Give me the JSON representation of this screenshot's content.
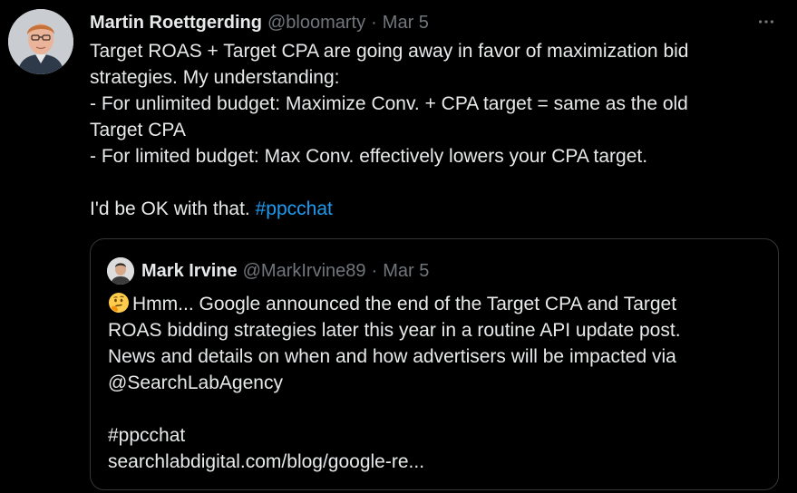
{
  "tweet": {
    "author_name": "Martin Roettgerding",
    "author_handle": "@bloomarty",
    "separator": "·",
    "date": "Mar 5",
    "lines": [
      "Target ROAS + Target CPA are going away in favor of maximization bid",
      "strategies. My understanding:",
      "- For unlimited budget: Maximize Conv. + CPA target = same as the old",
      "Target CPA",
      "- For limited budget: Max Conv. effectively lowers your CPA target.",
      "",
      "I'd be OK with that. "
    ],
    "hashtag": "#ppcchat",
    "more_icon": "more-horizontal-icon"
  },
  "quoted_tweet": {
    "author_name": "Mark Irvine",
    "author_handle": "@MarkIrvine89",
    "separator": "·",
    "date": "Mar 5",
    "emoji": "thinking-face-emoji",
    "lines": [
      "Hmm... Google announced the end of the Target CPA and Target",
      "ROAS bidding strategies later this year in a routine API update post.",
      "News and details on when and how advertisers will be impacted via",
      "@SearchLabAgency",
      "",
      "#ppcchat",
      "searchlabdigital.com/blog/google-re..."
    ]
  },
  "colors": {
    "background": "#000000",
    "text": "#e7e9ea",
    "secondary": "#71767b",
    "link": "#1d9bf0",
    "border": "#333639"
  }
}
